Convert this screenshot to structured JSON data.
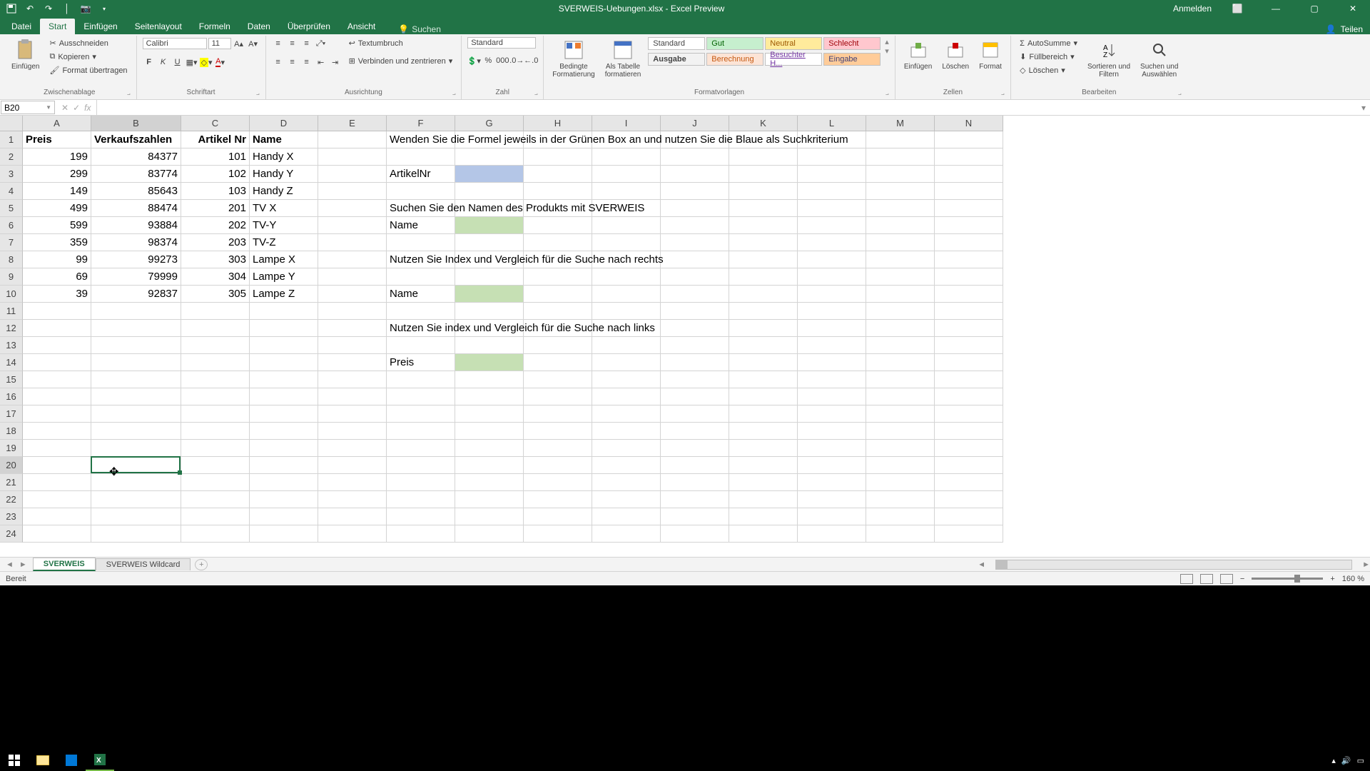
{
  "title": "SVERWEIS-Uebungen.xlsx - Excel Preview",
  "titlebar": {
    "anmelden": "Anmelden",
    "teilen": "Teilen"
  },
  "tabs": {
    "datei": "Datei",
    "start": "Start",
    "einfuegen": "Einfügen",
    "seitenlayout": "Seitenlayout",
    "formeln": "Formeln",
    "daten": "Daten",
    "ueberpruefen": "Überprüfen",
    "ansicht": "Ansicht",
    "suchen": "Suchen"
  },
  "ribbon": {
    "zwischenablage": {
      "label": "Zwischenablage",
      "einfuegen": "Einfügen",
      "ausschneiden": "Ausschneiden",
      "kopieren": "Kopieren",
      "format_uebertragen": "Format übertragen"
    },
    "schriftart": {
      "label": "Schriftart",
      "font": "Calibri",
      "size": "11"
    },
    "ausrichtung": {
      "label": "Ausrichtung",
      "textumbruch": "Textumbruch",
      "verbinden": "Verbinden und zentrieren"
    },
    "zahl": {
      "label": "Zahl",
      "format": "Standard"
    },
    "formatvorlagen": {
      "label": "Formatvorlagen",
      "bedingte": "Bedingte\nFormatierung",
      "als_tabelle": "Als Tabelle\nformatieren",
      "standard": "Standard",
      "gut": "Gut",
      "neutral": "Neutral",
      "schlecht": "Schlecht",
      "ausgabe": "Ausgabe",
      "berechnung": "Berechnung",
      "besuchter": "Besuchter H...",
      "eingabe": "Eingabe"
    },
    "zellen": {
      "label": "Zellen",
      "einfuegen": "Einfügen",
      "loeschen": "Löschen",
      "format": "Format"
    },
    "bearbeiten": {
      "label": "Bearbeiten",
      "autosumme": "AutoSumme",
      "fuellbereich": "Füllbereich",
      "loeschen": "Löschen",
      "sortieren": "Sortieren und\nFiltern",
      "suchen": "Suchen und\nAuswählen"
    }
  },
  "formula_bar": {
    "name_box": "B20",
    "formula": ""
  },
  "columns": [
    "A",
    "B",
    "C",
    "D",
    "E",
    "F",
    "G",
    "H",
    "I",
    "J",
    "K",
    "L",
    "M",
    "N"
  ],
  "rows": [
    1,
    2,
    3,
    4,
    5,
    6,
    7,
    8,
    9,
    10,
    11,
    12,
    13,
    14,
    15,
    16,
    17,
    18,
    19,
    20,
    21,
    22,
    23,
    24
  ],
  "sheet": {
    "headers": {
      "A1": "Preis",
      "B1": "Verkaufszahlen",
      "C1": "Artikel Nr",
      "D1": "Name"
    },
    "data": [
      {
        "preis": "199",
        "vk": "84377",
        "anr": "101",
        "name": "Handy X"
      },
      {
        "preis": "299",
        "vk": "83774",
        "anr": "102",
        "name": "Handy Y"
      },
      {
        "preis": "149",
        "vk": "85643",
        "anr": "103",
        "name": "Handy Z"
      },
      {
        "preis": "499",
        "vk": "88474",
        "anr": "201",
        "name": "TV X"
      },
      {
        "preis": "599",
        "vk": "93884",
        "anr": "202",
        "name": "TV-Y"
      },
      {
        "preis": "359",
        "vk": "98374",
        "anr": "203",
        "name": "TV-Z"
      },
      {
        "preis": "99",
        "vk": "99273",
        "anr": "303",
        "name": "Lampe X"
      },
      {
        "preis": "69",
        "vk": "79999",
        "anr": "304",
        "name": "Lampe Y"
      },
      {
        "preis": "39",
        "vk": "92837",
        "anr": "305",
        "name": "Lampe Z"
      }
    ],
    "instructions": {
      "F1": "Wenden Sie die Formel jeweils in der Grünen Box an und nutzen Sie die Blaue als Suchkriterium",
      "F3": "ArtikelNr",
      "F5": "Suchen Sie den Namen des Produkts mit SVERWEIS",
      "F6": "Name",
      "F8": "Nutzen Sie Index und Vergleich für die Suche nach rechts",
      "F10": "Name",
      "F12": "Nutzen Sie index und Vergleich für die Suche nach links",
      "F14": "Preis"
    }
  },
  "sheet_tabs": {
    "tab1": "SVERWEIS",
    "tab2": "SVERWEIS Wildcard"
  },
  "status": {
    "bereit": "Bereit",
    "zoom": "160 %"
  },
  "selected_cell": "B20"
}
